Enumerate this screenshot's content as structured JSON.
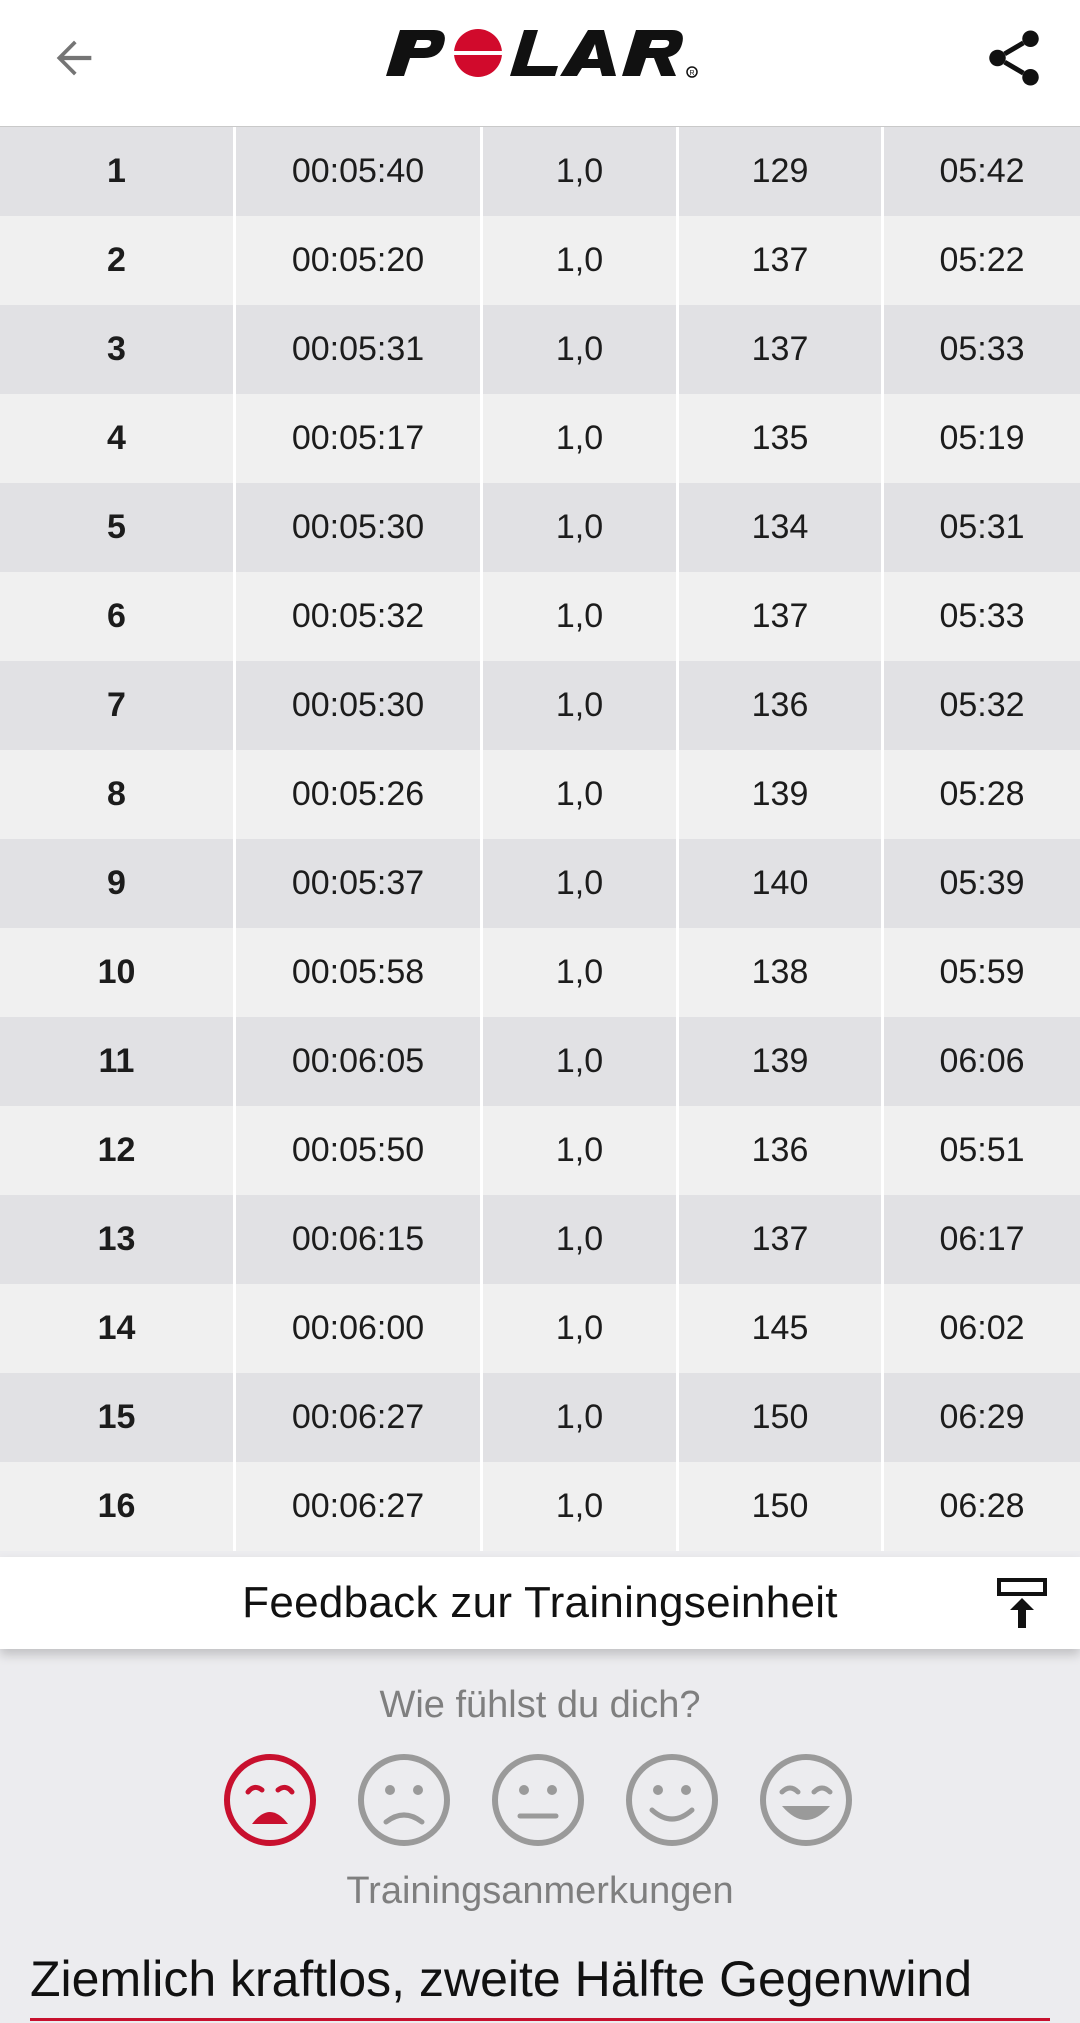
{
  "header": {
    "back_icon": "arrow-left-icon",
    "logo_text": "POLAR",
    "share_icon": "share-icon"
  },
  "laps": [
    {
      "lap": "1",
      "time": "00:05:40",
      "distance": "1,0",
      "hr": "129",
      "pace": "05:42"
    },
    {
      "lap": "2",
      "time": "00:05:20",
      "distance": "1,0",
      "hr": "137",
      "pace": "05:22"
    },
    {
      "lap": "3",
      "time": "00:05:31",
      "distance": "1,0",
      "hr": "137",
      "pace": "05:33"
    },
    {
      "lap": "4",
      "time": "00:05:17",
      "distance": "1,0",
      "hr": "135",
      "pace": "05:19"
    },
    {
      "lap": "5",
      "time": "00:05:30",
      "distance": "1,0",
      "hr": "134",
      "pace": "05:31"
    },
    {
      "lap": "6",
      "time": "00:05:32",
      "distance": "1,0",
      "hr": "137",
      "pace": "05:33"
    },
    {
      "lap": "7",
      "time": "00:05:30",
      "distance": "1,0",
      "hr": "136",
      "pace": "05:32"
    },
    {
      "lap": "8",
      "time": "00:05:26",
      "distance": "1,0",
      "hr": "139",
      "pace": "05:28"
    },
    {
      "lap": "9",
      "time": "00:05:37",
      "distance": "1,0",
      "hr": "140",
      "pace": "05:39"
    },
    {
      "lap": "10",
      "time": "00:05:58",
      "distance": "1,0",
      "hr": "138",
      "pace": "05:59"
    },
    {
      "lap": "11",
      "time": "00:06:05",
      "distance": "1,0",
      "hr": "139",
      "pace": "06:06"
    },
    {
      "lap": "12",
      "time": "00:05:50",
      "distance": "1,0",
      "hr": "136",
      "pace": "05:51"
    },
    {
      "lap": "13",
      "time": "00:06:15",
      "distance": "1,0",
      "hr": "137",
      "pace": "06:17"
    },
    {
      "lap": "14",
      "time": "00:06:00",
      "distance": "1,0",
      "hr": "145",
      "pace": "06:02"
    },
    {
      "lap": "15",
      "time": "00:06:27",
      "distance": "1,0",
      "hr": "150",
      "pace": "06:29"
    },
    {
      "lap": "16",
      "time": "00:06:27",
      "distance": "1,0",
      "hr": "150",
      "pace": "06:28"
    }
  ],
  "feedback": {
    "title": "Feedback zur Trainingseinheit",
    "collapse_icon": "collapse-up-icon",
    "question": "Wie fühlst du dich?",
    "feelings": [
      "very-bad",
      "bad",
      "neutral",
      "good",
      "very-good"
    ],
    "selected_feeling": "very-bad",
    "selected_color": "#c8102e",
    "unselected_color": "#9a9a9a",
    "notes_label": "Trainingsanmerkungen",
    "notes_text": "Ziemlich kraftlos, zweite Hälfte Gegenwind"
  },
  "colors": {
    "brand_red": "#d10a2c",
    "row_dark": "#e1e1e4",
    "row_light": "#f0f0f0"
  }
}
